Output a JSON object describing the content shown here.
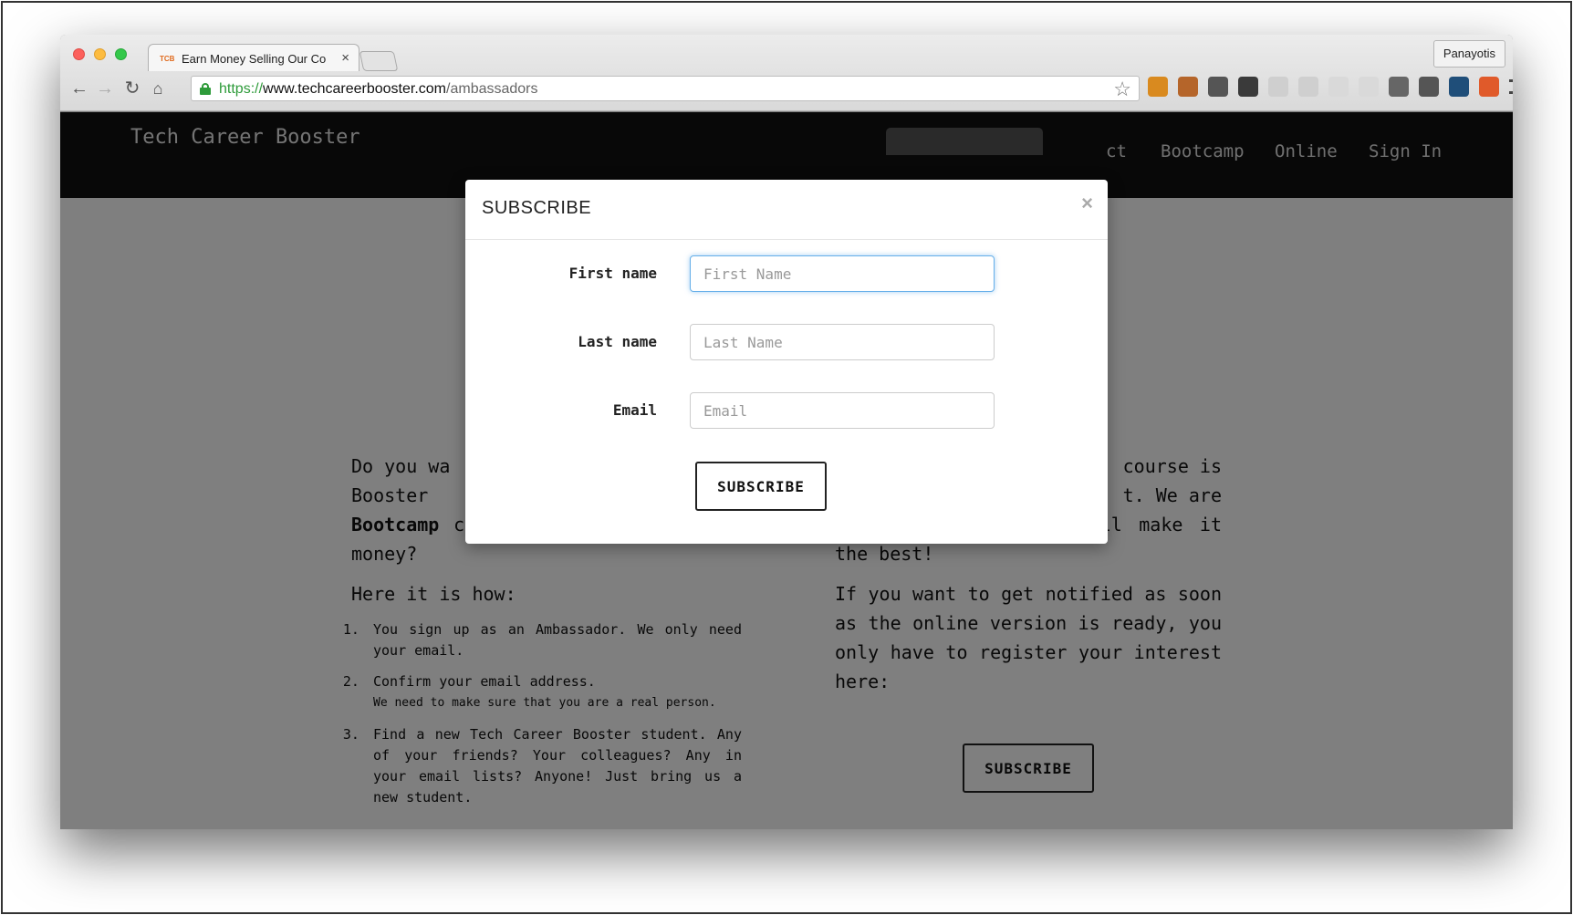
{
  "browser": {
    "tab_favicon": "TCB",
    "tab_title": "Earn Money Selling Our Co",
    "tab_close": "×",
    "profile_name": "Panayotis",
    "url_scheme": "https://",
    "url_host": "www.techcareerbooster.com",
    "url_path": "/ambassadors",
    "nav_icons": [
      "back-arrow-icon",
      "forward-arrow-icon",
      "reload-icon",
      "home-icon"
    ],
    "extension_colors": [
      "#d98a1f",
      "#b5652a",
      "#555555",
      "#3a3a3a",
      "#cfcfcf",
      "#cfcfcf",
      "#d9d9d9",
      "#d9d9d9",
      "#666666",
      "#555555",
      "#1f4e79",
      "#e05a2a",
      "#444444"
    ]
  },
  "site": {
    "brand": "Tech Career Booster",
    "nav_links": [
      "ct",
      "Bootcamp",
      "Online",
      "Sign In"
    ]
  },
  "content": {
    "left_intro_start": "Do you wa",
    "left_intro_mid": "Booster",
    "left_intro_bold": "Bootcamp",
    "left_intro_end": " course and earn some good money?",
    "how_heading": "Here it is how:",
    "steps": [
      {
        "text": "You sign up as an Ambassador. We only need your email.",
        "sub": ""
      },
      {
        "text": "Confirm your email address.",
        "sub": "We need to make sure that you are a real person."
      },
      {
        "text": "Find a new Tech Career Booster student. Any of your friends? Your colleagues? Any in your email lists? Anyone! Just bring us a new student.",
        "sub": ""
      }
    ],
    "right_intro_line1": "course is",
    "right_intro_line2": "t. We are",
    "right_intro_rest": "trying our best and will make it the best!",
    "right_notify": "If you want to get notified as soon as the online version is ready, you only have to register your interest here:",
    "subscribe_button": "SUBSCRIBE"
  },
  "modal": {
    "title": "SUBSCRIBE",
    "close_label": "×",
    "first_name_label": "First name",
    "first_name_placeholder": "First Name",
    "last_name_label": "Last name",
    "last_name_placeholder": "Last Name",
    "email_label": "Email",
    "email_placeholder": "Email",
    "subscribe_button": "SUBSCRIBE"
  }
}
